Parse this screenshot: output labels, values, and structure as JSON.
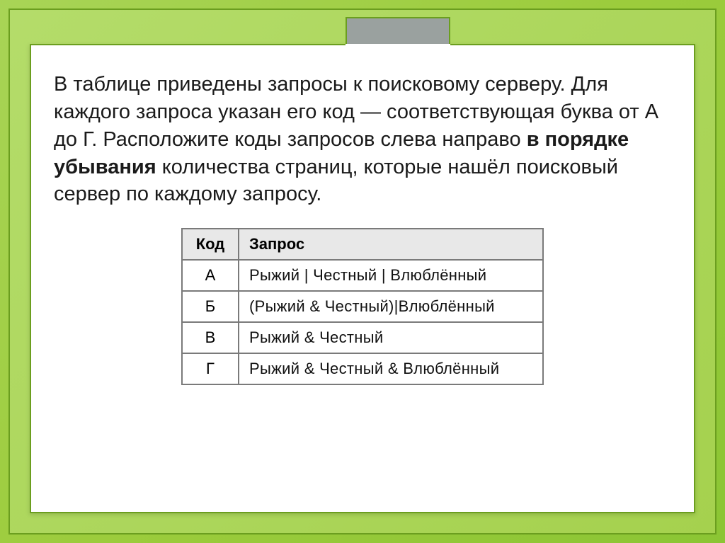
{
  "task": {
    "part1": "В таблице приведены запросы к поисковому серверу. Для каждого запроса указан его код — соответствующая буква от А до Г. Расположите коды запросов слева направо ",
    "bold": "в порядке убывания",
    "part2": " количества страниц, которые нашёл поисковый сервер по каждому запросу."
  },
  "table": {
    "headers": {
      "code": "Код",
      "query": "Запрос"
    },
    "rows": [
      {
        "code": "А",
        "query": "Рыжий | Честный | Влюблённый"
      },
      {
        "code": "Б",
        "query": "(Рыжий & Честный)|Влюблённый"
      },
      {
        "code": "В",
        "query": "Рыжий & Честный"
      },
      {
        "code": "Г",
        "query": "Рыжий & Честный & Влюблённый"
      }
    ]
  }
}
